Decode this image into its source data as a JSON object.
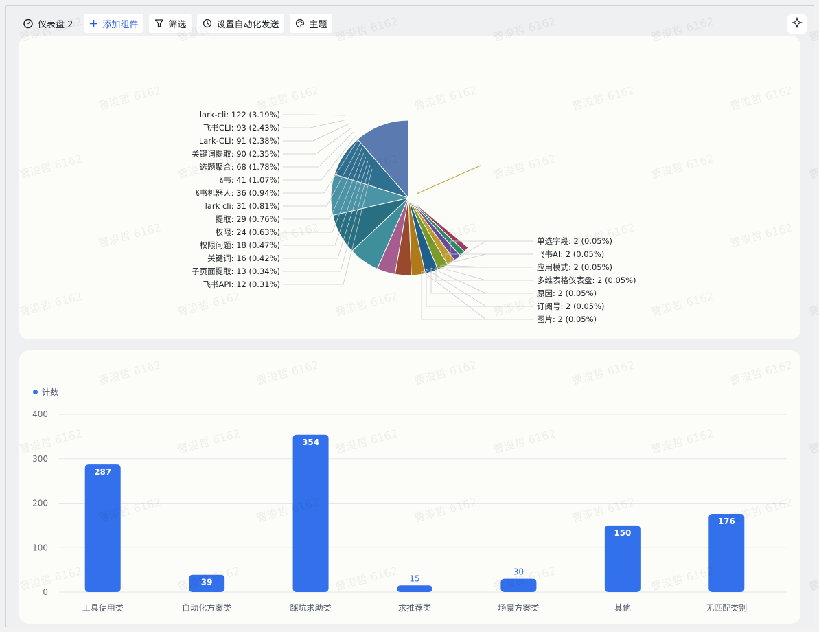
{
  "toolbar": {
    "dashboard_title": "仪表盘 2",
    "add_component": "添加组件",
    "filter": "筛选",
    "automation": "设置自动化发送",
    "theme": "主题"
  },
  "pie_chart": {
    "left_labels": [
      "lark-cli: 122 (3.19%)",
      "飞书CLI: 93 (2.43%)",
      "Lark-CLI: 91 (2.38%)",
      "关键词提取: 90 (2.35%)",
      "选题聚合: 68 (1.78%)",
      "飞书: 41 (1.07%)",
      "飞书机器人: 36 (0.94%)",
      "lark cli: 31 (0.81%)",
      "提取: 29 (0.76%)",
      "权限: 24 (0.63%)",
      "权限问题: 18 (0.47%)",
      "关键词: 16 (0.42%)",
      "子页面提取: 13 (0.34%)",
      "飞书API: 12 (0.31%)"
    ],
    "right_labels": [
      "单选字段: 2 (0.05%)",
      "飞书AI: 2 (0.05%)",
      "应用模式: 2 (0.05%)",
      "多维表格仪表盘: 2 (0.05%)",
      "原因: 2 (0.05%)",
      "订阅号: 2 (0.05%)",
      "图片: 2 (0.05%)"
    ]
  },
  "chart_data": [
    {
      "type": "pie",
      "slices": [
        {
          "label": "lark-cli",
          "value": 122,
          "percent": 3.19
        },
        {
          "label": "飞书CLI",
          "value": 93,
          "percent": 2.43
        },
        {
          "label": "Lark-CLI",
          "value": 91,
          "percent": 2.38
        },
        {
          "label": "关键词提取",
          "value": 90,
          "percent": 2.35
        },
        {
          "label": "选题聚合",
          "value": 68,
          "percent": 1.78
        },
        {
          "label": "飞书",
          "value": 41,
          "percent": 1.07
        },
        {
          "label": "飞书机器人",
          "value": 36,
          "percent": 0.94
        },
        {
          "label": "lark cli",
          "value": 31,
          "percent": 0.81
        },
        {
          "label": "提取",
          "value": 29,
          "percent": 0.76
        },
        {
          "label": "权限",
          "value": 24,
          "percent": 0.63
        },
        {
          "label": "权限问题",
          "value": 18,
          "percent": 0.47
        },
        {
          "label": "关键词",
          "value": 16,
          "percent": 0.42
        },
        {
          "label": "子页面提取",
          "value": 13,
          "percent": 0.34
        },
        {
          "label": "飞书API",
          "value": 12,
          "percent": 0.31
        },
        {
          "label": "单选字段",
          "value": 2,
          "percent": 0.05
        },
        {
          "label": "飞书AI",
          "value": 2,
          "percent": 0.05
        },
        {
          "label": "应用模式",
          "value": 2,
          "percent": 0.05
        },
        {
          "label": "多维表格仪表盘",
          "value": 2,
          "percent": 0.05
        },
        {
          "label": "原因",
          "value": 2,
          "percent": 0.05
        },
        {
          "label": "订阅号",
          "value": 2,
          "percent": 0.05
        },
        {
          "label": "图片",
          "value": 2,
          "percent": 0.05
        }
      ]
    },
    {
      "type": "bar",
      "categories": [
        "工具使用类",
        "自动化方案类",
        "踩坑求助类",
        "求推荐类",
        "场景方案类",
        "其他",
        "无匹配类别"
      ],
      "series": [
        {
          "name": "计数",
          "values": [
            287,
            39,
            354,
            15,
            30,
            150,
            176
          ]
        }
      ],
      "ylim": [
        0,
        400
      ],
      "yticks": [
        0,
        100,
        200,
        300,
        400
      ],
      "grid": true,
      "legend": "top-left",
      "color": "#3370eb"
    }
  ],
  "watermark": "曹浚哲 6162"
}
